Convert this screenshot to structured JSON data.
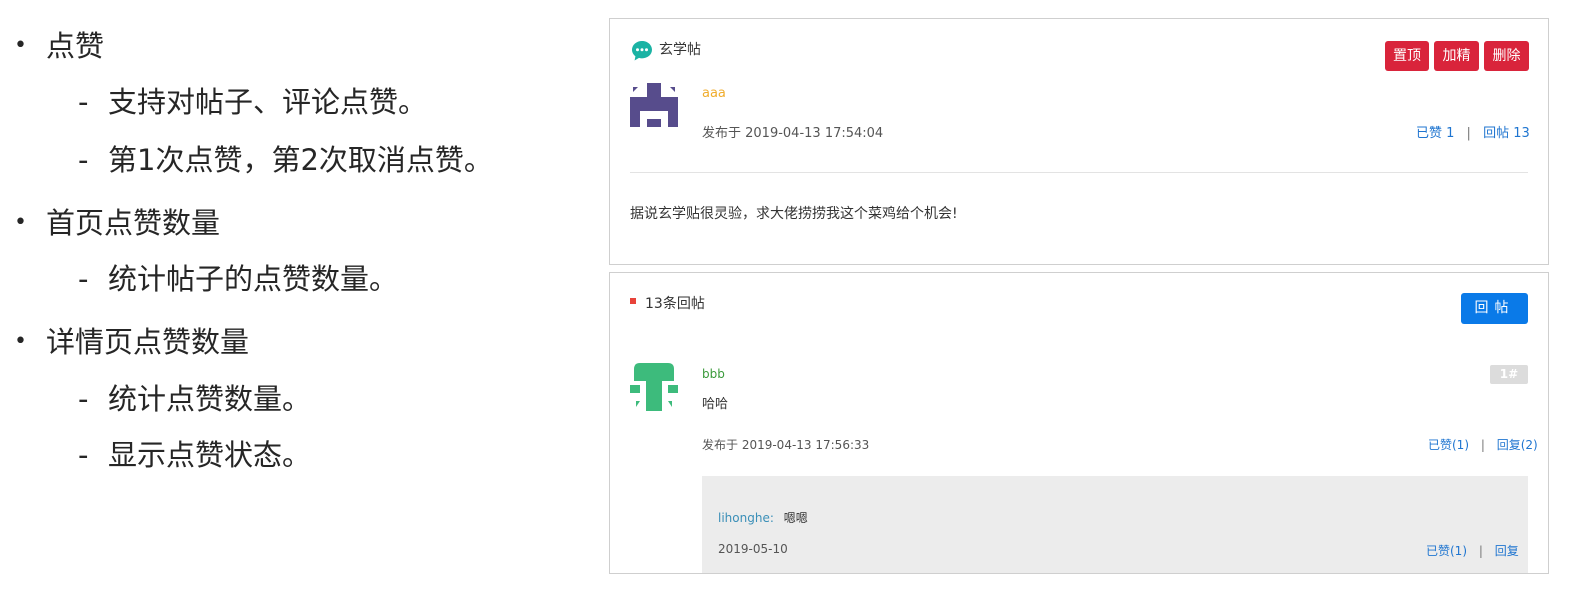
{
  "outline": {
    "item1": "点赞",
    "item1_sub1": "支持对帖子、评论点赞。",
    "item1_sub2": "第1次点赞，第2次取消点赞。",
    "item2": "首页点赞数量",
    "item2_sub1": "统计帖子的点赞数量。",
    "item3": "详情页点赞数量",
    "item3_sub1": "统计点赞数量。",
    "item3_sub2": "显示点赞状态。",
    "bullet": "•",
    "dash": "-"
  },
  "post": {
    "category": "玄学帖",
    "buttons": {
      "top": "置顶",
      "highlight": "加精",
      "delete": "删除"
    },
    "author": "aaa",
    "published": "发布于 2019-04-13 17:54:04",
    "likes": "已赞 1",
    "replies": "回帖 13",
    "divider": "|",
    "content": "据说玄学贴很灵验，求大佬捞捞我这个菜鸡给个机会!",
    "colors": {
      "author": "#f0ad2e",
      "category_icon": "#1bb3a4",
      "avatar": "#574c8c"
    }
  },
  "replies": {
    "count_label": "13条回帖",
    "reply_button": "回帖",
    "items": [
      {
        "author": "bbb",
        "floor": "1#",
        "content": "哈哈",
        "published": "发布于 2019-04-13 17:56:33",
        "likes": "已赞(1)",
        "reply": "回复(2)",
        "comment": {
          "author": "lihonghe:",
          "content": "嗯嗯",
          "date": "2019-05-10",
          "likes": "已赞(1)",
          "reply": "回复"
        }
      }
    ],
    "colors": {
      "marker": "#e8433a",
      "author": "#3a9a3a",
      "avatar": "#3dbb7c",
      "comment_author": "#3a8fb8",
      "comment_bg": "#ececec"
    }
  }
}
